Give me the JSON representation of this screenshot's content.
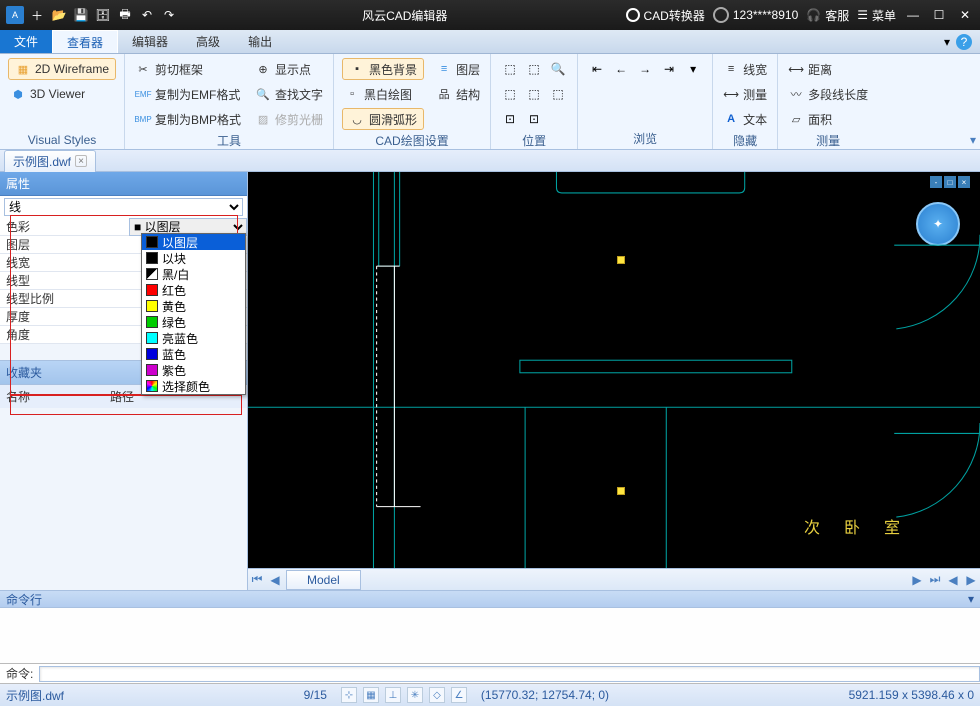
{
  "title": {
    "app": "风云CAD编辑器",
    "converter": "CAD转换器",
    "user": "123****8910",
    "service": "客服",
    "menu": "菜单"
  },
  "menus": {
    "file": "文件",
    "viewer": "查看器",
    "editor": "编辑器",
    "advanced": "高级",
    "output": "输出"
  },
  "ribbon": {
    "visual": {
      "wireframe": "2D Wireframe",
      "viewer3d": "3D Viewer",
      "label": "Visual Styles"
    },
    "tools": {
      "clip": "剪切框架",
      "emf": "复制为EMF格式",
      "bmp": "复制为BMP格式",
      "showpt": "显示点",
      "findtext": "查找文字",
      "trimraster": "修剪光栅",
      "label": "工具"
    },
    "cadset": {
      "blackbg": "黑色背景",
      "bwdraw": "黑白绘图",
      "smootharc": "圆滑弧形",
      "layer": "图层",
      "struct": "结构",
      "label": "CAD绘图设置"
    },
    "pos": {
      "label": "位置"
    },
    "browse": {
      "label": "浏览"
    },
    "hide": {
      "lw": "线宽",
      "measure": "测量",
      "text": "文本",
      "label": "隐藏"
    },
    "meas": {
      "dist": "距离",
      "polylen": "多段线长度",
      "area": "面积",
      "label": "测量"
    }
  },
  "doc": {
    "tab": "示例图.dwf"
  },
  "props": {
    "header": "属性",
    "entity": "线",
    "rows": {
      "color": "色彩",
      "layer": "图层",
      "lw": "线宽",
      "lt": "线型",
      "ltscale": "线型比例",
      "thick": "厚度",
      "angle": "角度"
    },
    "colorval": "以图层",
    "fav": "收藏夹",
    "name": "名称",
    "path": "路径"
  },
  "dd": {
    "bylayer": "以图层",
    "byblock": "以块",
    "bw": "黑/白",
    "red": "红色",
    "yellow": "黄色",
    "green": "绿色",
    "cyan": "亮蓝色",
    "blue": "蓝色",
    "magenta": "紫色",
    "choose": "选择颜色"
  },
  "canvas": {
    "model": "Model",
    "room": "次 卧 室"
  },
  "cmd": {
    "header": "命令行",
    "prompt": "命令:"
  },
  "status": {
    "file": "示例图.dwf",
    "pages": "9/15",
    "coords": "(15770.32; 12754.74; 0)",
    "dims": "5921.159 x 5398.46 x 0"
  }
}
